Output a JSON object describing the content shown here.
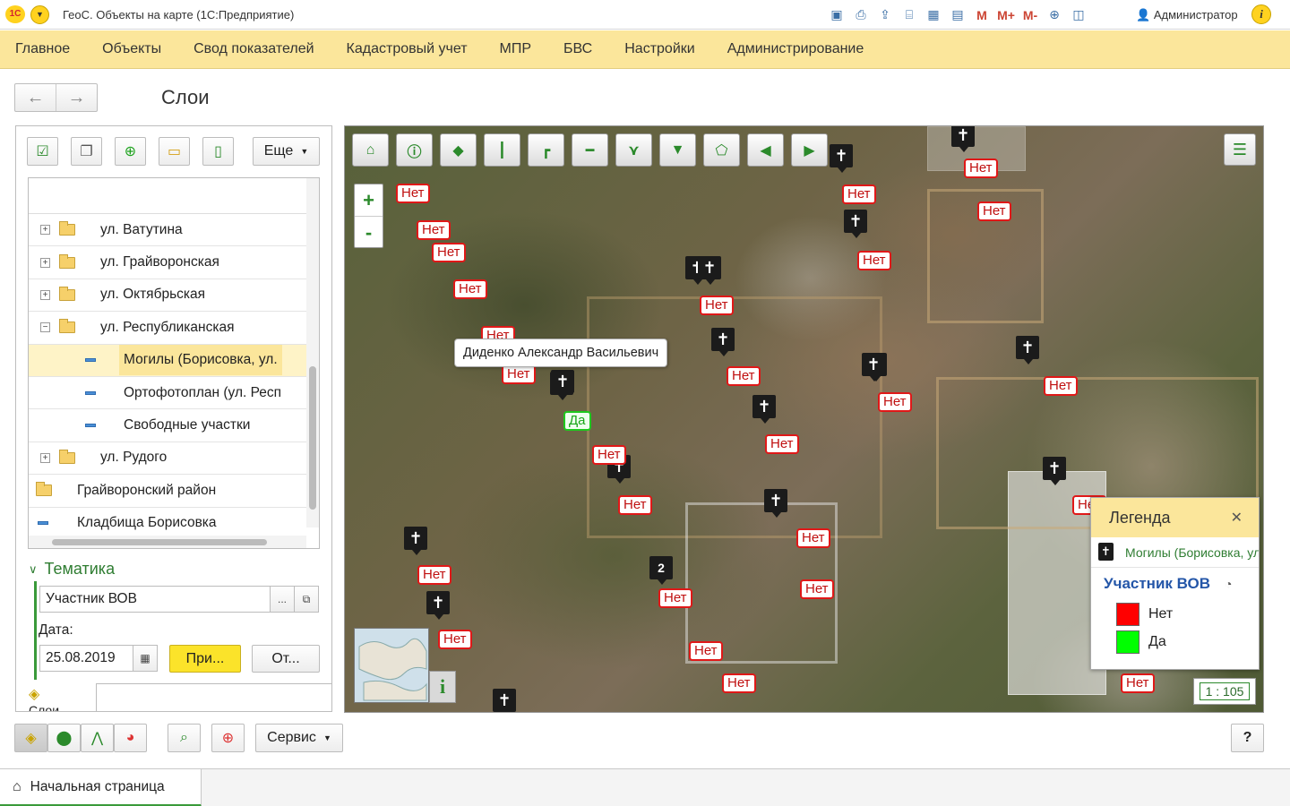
{
  "app": {
    "title": "ГеоС. Объекты на карте   (1С:Предприятие)",
    "logo_text": "1С",
    "user": "Администратор",
    "memory_buttons": [
      "M",
      "M+",
      "M-"
    ]
  },
  "sections": [
    "Главное",
    "Объекты",
    "Свод показателей",
    "Кадастровый учет",
    "МПР",
    "БВС",
    "Настройки",
    "Администрирование"
  ],
  "form": {
    "title": "Слои",
    "more_label": "Еще"
  },
  "tree": {
    "rows": [
      {
        "label": "ул. Ватутина",
        "expander": "+"
      },
      {
        "label": "ул. Грайворонская",
        "expander": "+"
      },
      {
        "label": "ул. Октябрьская",
        "expander": "+"
      },
      {
        "label": "ул. Республиканская",
        "expander": "−"
      },
      {
        "label": "Могилы (Борисовка, ул."
      },
      {
        "label": "Ортофотоплан (ул. Респ"
      },
      {
        "label": "Свободные участки"
      },
      {
        "label": "ул. Рудого",
        "expander": "+"
      },
      {
        "label": "Грайворонский район"
      },
      {
        "label": "Кладбища Борисовка"
      }
    ]
  },
  "thematic": {
    "title": "Тематика",
    "value": "Участник ВОВ",
    "choose_label": "...",
    "date_label": "Дата:",
    "date_value": "25.08.2019",
    "apply_label": "При...",
    "cancel_label": "От..."
  },
  "layers_tab": {
    "label": "Слои"
  },
  "map": {
    "tooltip": "Диденко Александр Васильевич",
    "scale": "1 : 105",
    "minimap_toggle": "i",
    "cluster_count": "2",
    "zoom_in": "+",
    "zoom_out": "-",
    "tags": {
      "no": "Нет",
      "yes": "Да"
    }
  },
  "legend": {
    "title": "Легенда",
    "layer": "Могилы (Борисовка, ул.",
    "group": "Участник ВОВ",
    "items": [
      {
        "label": "Нет",
        "color": "#ff0000"
      },
      {
        "label": "Да",
        "color": "#00ff00"
      }
    ]
  },
  "bottom": {
    "service_label": "Сервис",
    "help_label": "?",
    "home_tab": "Начальная страница"
  },
  "colors": {
    "accent": "#fbe69b",
    "green_accent": "#3a9a3a",
    "tag_no": "#e01818",
    "tag_yes": "#1ec81e"
  }
}
